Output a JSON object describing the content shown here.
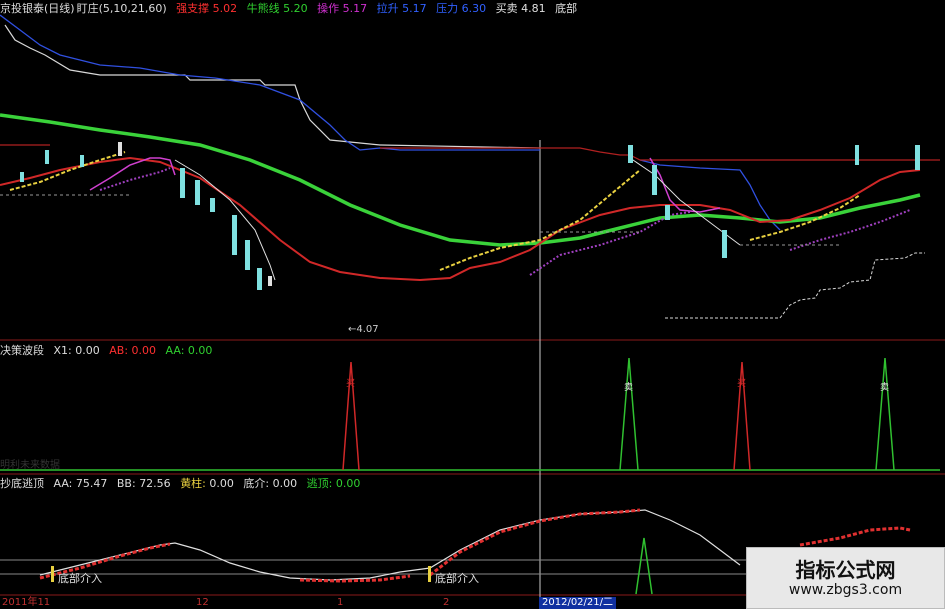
{
  "main_panel": {
    "name_label": "京投银泰(日线)",
    "mode_label": "盯庄",
    "params": "(5,10,21,60)",
    "indicators": [
      {
        "label": "强支撑",
        "value": "5.02",
        "color": "#ff3030",
        "value_color": "#ff3030"
      },
      {
        "label": "牛熊线",
        "value": "5.20",
        "color": "#30d030",
        "value_color": "#30d030"
      },
      {
        "label": "操作",
        "value": "5.17",
        "color": "#d030d0",
        "value_color": "#d030d0"
      },
      {
        "label": "拉升",
        "value": "5.17",
        "color": "#3060ff",
        "value_color": "#3060ff"
      },
      {
        "label": "压力",
        "value": "6.30",
        "color": "#3060ff",
        "value_color": "#3060ff"
      },
      {
        "label": "买卖",
        "value": "4.81",
        "color": "#e0e0e0",
        "value_color": "#e0e0e0"
      },
      {
        "label": "底部",
        "value": "",
        "color": "#e0e0e0",
        "value_color": "#e0e0e0"
      }
    ],
    "low_price_label": "←4.07"
  },
  "panel2": {
    "name_label": "决策波段",
    "items": [
      {
        "label": "X1:",
        "value": "0.00",
        "color": "#e0e0e0"
      },
      {
        "label": "AB:",
        "value": "0.00",
        "color": "#ff3030"
      },
      {
        "label": "AA:",
        "value": "0.00",
        "color": "#30d030"
      }
    ],
    "faded_text": "明利未来数据",
    "peak_labels": [
      "买",
      "卖",
      "买",
      "卖"
    ]
  },
  "panel3": {
    "name_label": "抄底逃顶",
    "items": [
      {
        "label": "AA:",
        "value": "75.47",
        "color": "#e0e0e0"
      },
      {
        "label": "BB:",
        "value": "72.56",
        "color": "#e0e0e0"
      },
      {
        "label": "黄柱:",
        "value": "0.00",
        "color": "#e0e0e0"
      },
      {
        "label": "底介:",
        "value": "0.00",
        "color": "#e0e0e0"
      },
      {
        "label": "逃顶:",
        "value": "0.00",
        "color": "#30d030"
      }
    ],
    "bottom_entry_label": "底部介入"
  },
  "x_axis": {
    "labels": [
      "2011年11",
      "12",
      "1",
      "2"
    ],
    "cursor_date": "2012/02/21/二"
  },
  "watermark": {
    "title": "指标公式网",
    "url": "www.zbgs3.com"
  }
}
